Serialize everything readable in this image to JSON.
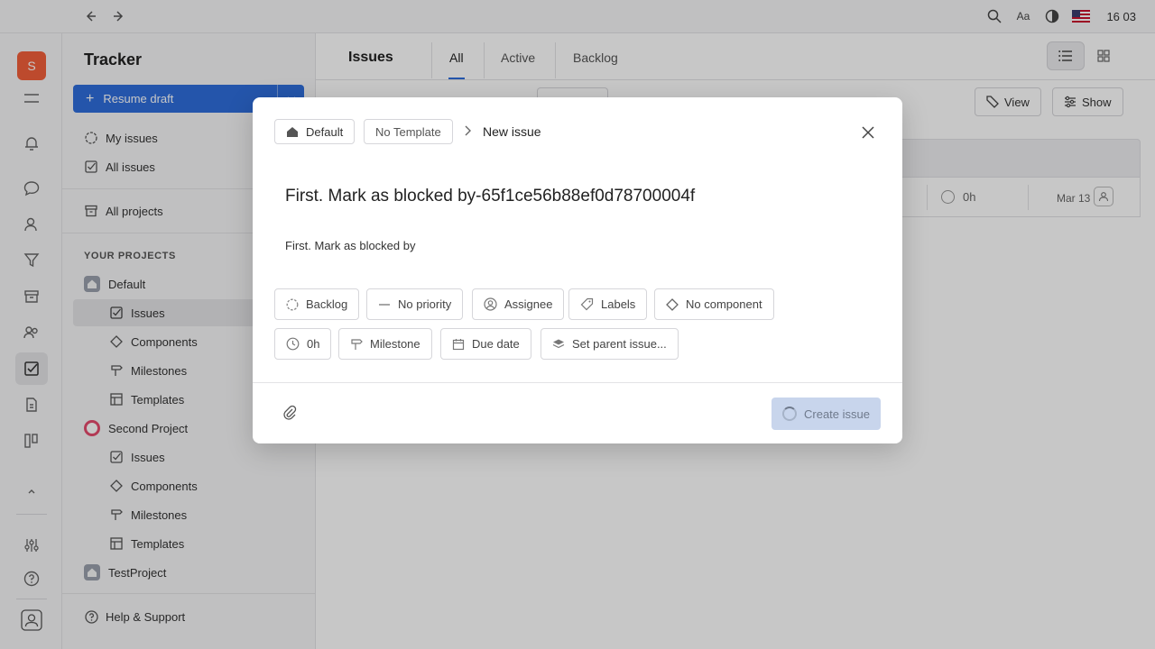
{
  "topbar": {
    "time": "16 03"
  },
  "rail": {
    "avatar_letter": "S"
  },
  "sidebar": {
    "title": "Tracker",
    "draft_button": "Resume draft",
    "my_issues": "My issues",
    "all_issues": "All issues",
    "all_projects": "All projects",
    "section_label": "YOUR PROJECTS",
    "projects": [
      {
        "name": "Default",
        "items": [
          "Issues",
          "Components",
          "Milestones",
          "Templates"
        ]
      },
      {
        "name": "Second Project",
        "items": [
          "Issues",
          "Components",
          "Milestones",
          "Templates"
        ]
      },
      {
        "name": "TestProject"
      }
    ],
    "help": "Help & Support"
  },
  "main": {
    "title": "Issues",
    "tabs": [
      "All",
      "Active",
      "Backlog"
    ],
    "active_tab": "All",
    "view_button": "View",
    "show_button": "Show",
    "row": {
      "estimate": "0h",
      "due": "Mar 13"
    }
  },
  "modal": {
    "project_chip": "Default",
    "template_chip": "No Template",
    "breadcrumb_current": "New issue",
    "title": "First. Mark as blocked by-65f1ce56b88ef0d78700004f",
    "description": "First. Mark as blocked by",
    "attributes": {
      "status": "Backlog",
      "priority": "No priority",
      "assignee": "Assignee",
      "labels": "Labels",
      "component": "No component",
      "estimate": "0h",
      "milestone": "Milestone",
      "due_date": "Due date",
      "parent": "Set parent issue..."
    },
    "create_button": "Create issue"
  }
}
